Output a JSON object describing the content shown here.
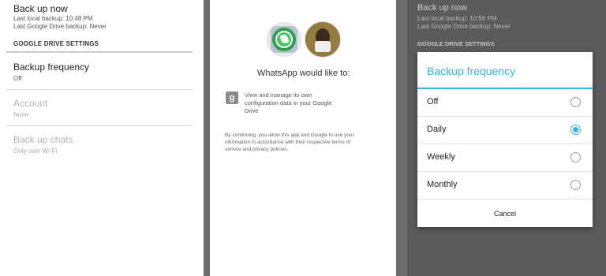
{
  "left_panel": {
    "backup_now": "Back up now",
    "last_local": "Last local backup: 10:48 PM",
    "last_drive": "Last Google Drive backup: Never",
    "section": "GOOGLE DRIVE SETTINGS",
    "frequency_title": "Backup frequency",
    "frequency_value": "Off",
    "account_title": "Account",
    "account_value": "None",
    "chats_title": "Back up chats",
    "chats_value": "Only over Wi-Fi"
  },
  "middle_panel": {
    "icons": [
      "whatsapp-icon",
      "user-avatar"
    ],
    "request": "WhatsApp would like to:",
    "permission_line1": "View and manage its own",
    "permission_line2": "configuration data in your Google",
    "permission_line3": "Drive",
    "disclaimer_line1": "By continuing, you allow this app and Google to use your",
    "disclaimer_line2": "information in accordance with their respective terms of",
    "disclaimer_line3": "service and privacy policies."
  },
  "right_panel": {
    "backup_now": "Back up now",
    "last_local": "Last local backup: 10:56 PM",
    "last_drive": "Last Google Drive backup: Never",
    "section": "GOOGLE DRIVE SETTINGS",
    "dialog": {
      "title": "Backup frequency",
      "options": [
        "Off",
        "Daily",
        "Weekly",
        "Monthly"
      ],
      "selected": "Daily",
      "cancel": "Cancel",
      "accent": "#33b5e5"
    }
  }
}
